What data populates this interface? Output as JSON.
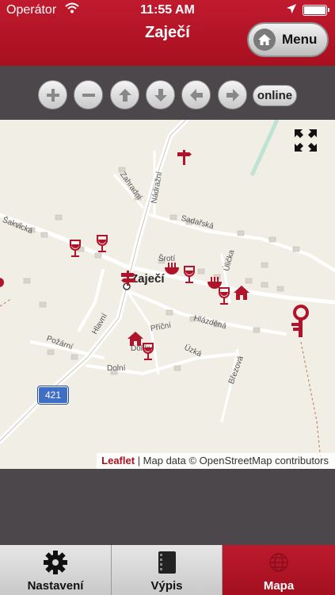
{
  "status": {
    "carrier": "Operátor",
    "time": "11:55 AM"
  },
  "header": {
    "title": "Zaječí",
    "menu_label": "Menu"
  },
  "toolbar": {
    "online_label": "online"
  },
  "map": {
    "place": "Zaječí",
    "road_number": "421",
    "attribution_link": "Leaflet",
    "attribution_text": "| Map data © OpenStreetMap contributors",
    "streets": [
      "Zahradní",
      "Nádražní",
      "Sadařská",
      "Šakvická",
      "Šrotí",
      "Úlička",
      "Hlavní",
      "Příční",
      "Hlázděná",
      "Požární",
      "Dolíky",
      "Úzká",
      "Dolní",
      "Březová"
    ]
  },
  "tabs": [
    {
      "label": "Nastavení"
    },
    {
      "label": "Výpis"
    },
    {
      "label": "Mapa"
    }
  ],
  "colors": {
    "accent": "#b01425",
    "poi": "#b0142a",
    "road_shield": "#3f6fc4"
  }
}
